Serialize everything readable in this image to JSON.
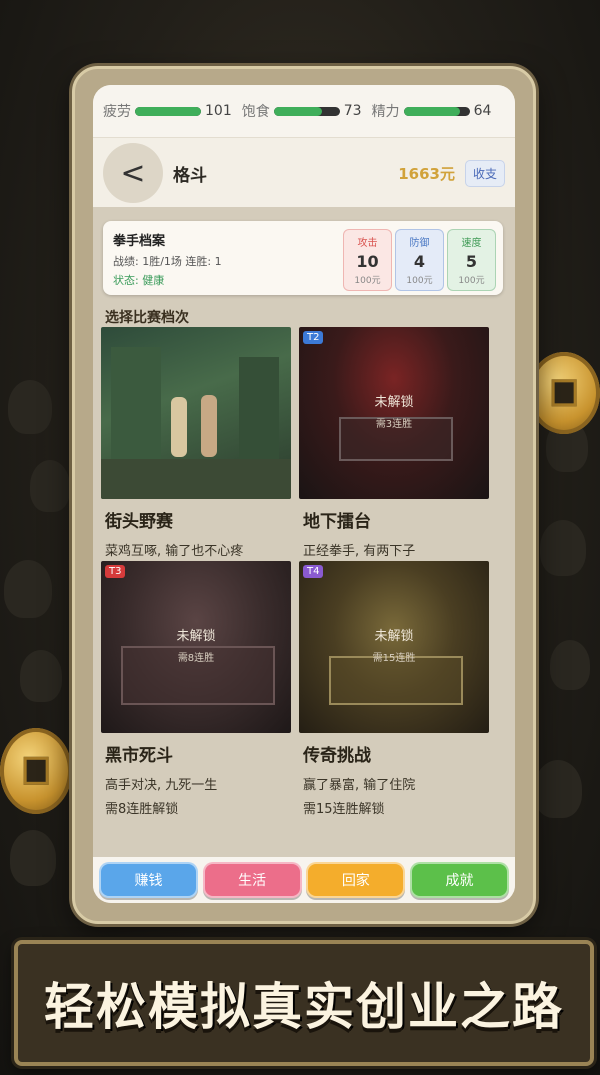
{
  "stats": [
    {
      "label": "疲劳",
      "value": "101",
      "fill": 1.0
    },
    {
      "label": "饱食",
      "value": "73",
      "fill": 0.73
    },
    {
      "label": "精力",
      "value": "64",
      "fill": 0.85
    }
  ],
  "header": {
    "back_icon": "chevron-left-icon",
    "title": "格斗",
    "money": "1663元",
    "ledger_label": "收支"
  },
  "record": {
    "title": "拳手档案",
    "line": "战绩: 1胜/1场  连胜: 1",
    "status": "状态: 健康",
    "attributes": [
      {
        "label": "攻击",
        "value": "10",
        "cost": "100元",
        "color": "#d9534f",
        "bg": "#fbe7e4"
      },
      {
        "label": "防御",
        "value": "4",
        "cost": "100元",
        "color": "#4a78c4",
        "bg": "#e4ebf8"
      },
      {
        "label": "速度",
        "value": "5",
        "cost": "100元",
        "color": "#3e9a55",
        "bg": "#e3f2e4"
      }
    ]
  },
  "section_title": "选择比赛档次",
  "tiers": [
    {
      "name": "街头野赛",
      "desc1": "菜鸡互啄, 输了也不心疼",
      "desc2": "",
      "tag": "",
      "tag_color": "",
      "locked": false,
      "lock_text": "",
      "lock_req": ""
    },
    {
      "name": "地下擂台",
      "desc1": "正经拳手, 有两下子",
      "desc2": "",
      "tag": "T2",
      "tag_color": "#3c7ad6",
      "locked": true,
      "lock_text": "未解锁",
      "lock_req": "需3连胜"
    },
    {
      "name": "黑市死斗",
      "desc1": "高手对决, 九死一生",
      "desc2": "需8连胜解锁",
      "tag": "T3",
      "tag_color": "#d63b3b",
      "locked": true,
      "lock_text": "未解锁",
      "lock_req": "需8连胜"
    },
    {
      "name": "传奇挑战",
      "desc1": "赢了暴富, 输了住院",
      "desc2": "需15连胜解锁",
      "tag": "T4",
      "tag_color": "#8a5ad0",
      "locked": true,
      "lock_text": "未解锁",
      "lock_req": "需15连胜"
    }
  ],
  "nav": [
    {
      "label": "赚钱",
      "color": "#5aa6ea"
    },
    {
      "label": "生活",
      "color": "#ec6e8a"
    },
    {
      "label": "回家",
      "color": "#f4ad2c"
    },
    {
      "label": "成就",
      "color": "#5cc04a"
    }
  ],
  "banner": "轻松模拟真实创业之路"
}
